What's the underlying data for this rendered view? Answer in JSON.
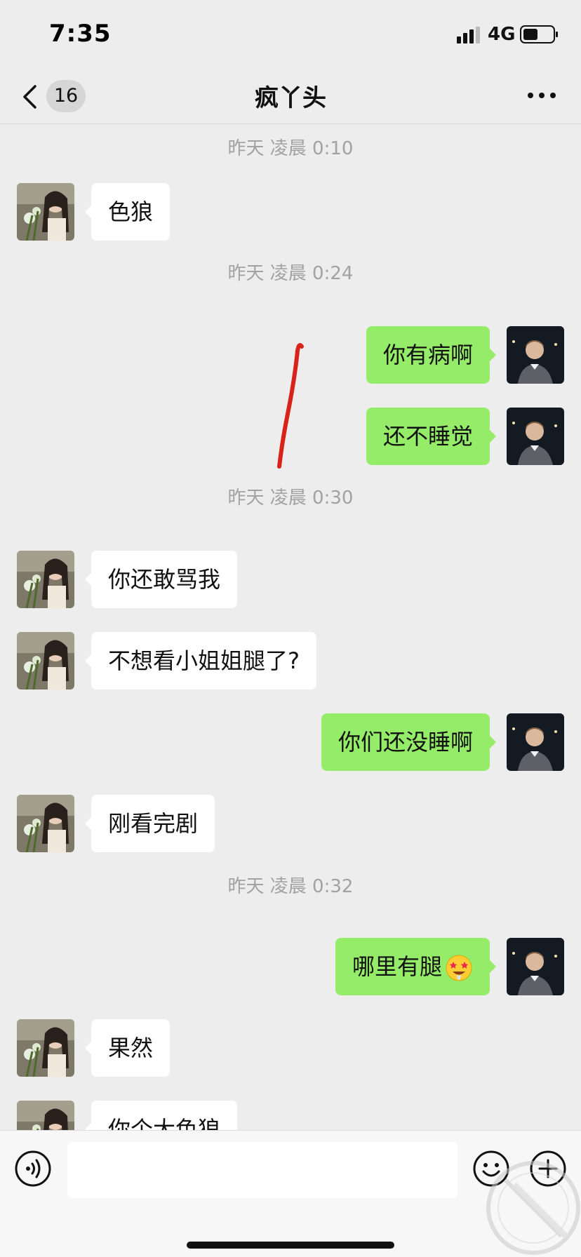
{
  "status_bar": {
    "time": "7:35",
    "network": "4G",
    "signal_icon": "cellular-signal-icon",
    "battery_icon": "battery-icon"
  },
  "nav": {
    "back_icon": "chevron-left-icon",
    "unread_count": "16",
    "title": "疯丫头",
    "more_icon": "ellipsis-icon"
  },
  "messages": {
    "ts1": "昨天 凌晨 0:10",
    "m1": "色狼",
    "ts2": "昨天 凌晨 0:24",
    "m2": "你有病啊",
    "m3": "还不睡觉",
    "ts3": "昨天 凌晨 0:30",
    "m4": "你还敢骂我",
    "m5": "不想看小姐姐腿了?",
    "m6": "你们还没睡啊",
    "m7": "刚看完剧",
    "ts4": "昨天 凌晨 0:32",
    "m8": "哪里有腿",
    "m8_emoji": "star-struck-emoji",
    "m9": "果然",
    "m10": "你个大色狼"
  },
  "input_bar": {
    "placeholder": "",
    "voice_icon": "voice-icon",
    "emoji_icon": "smiley-icon",
    "plus_icon": "plus-icon"
  },
  "colors": {
    "background": "#ededed",
    "bubble_self": "#95ec69",
    "bubble_other": "#ffffff",
    "timestamp": "#a2a2a2",
    "annotation_stroke": "#d8231a"
  }
}
